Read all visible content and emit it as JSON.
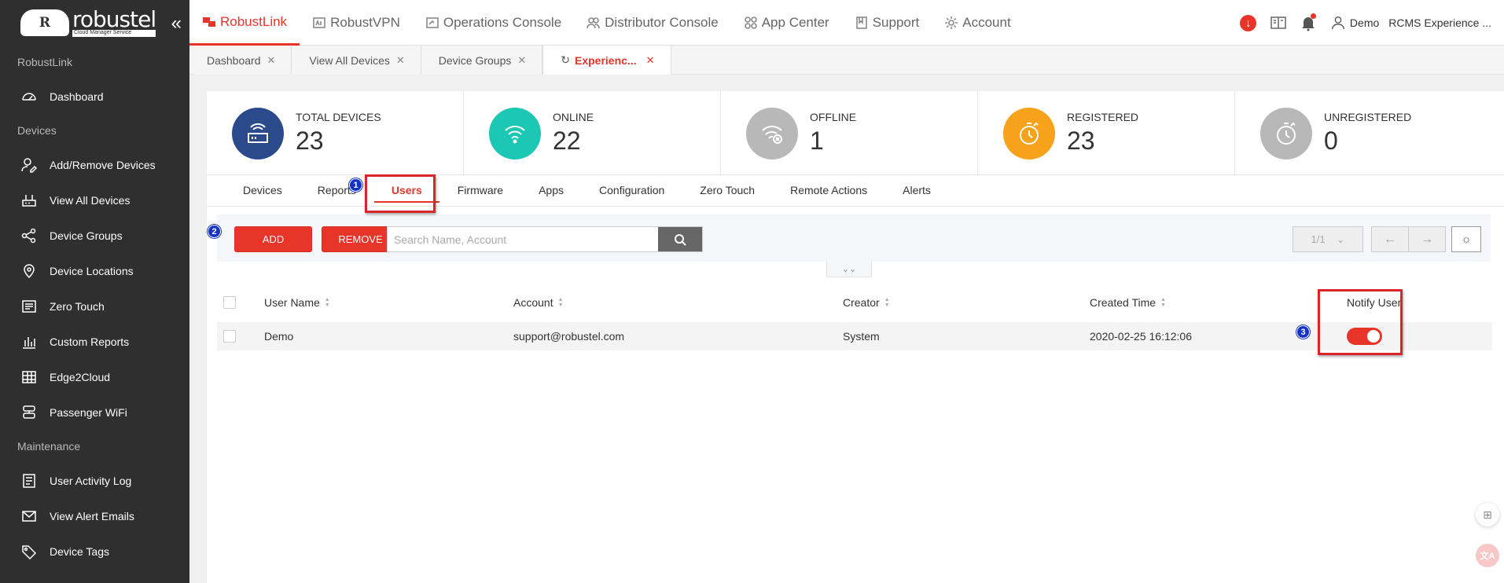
{
  "brand": {
    "name": "robustel",
    "sub": "Cloud Manager Service",
    "badge": "R"
  },
  "sidebar": {
    "sections": [
      {
        "title": "RobustLink",
        "items": [
          {
            "label": "Dashboard",
            "icon": "gauge-icon"
          }
        ]
      },
      {
        "title": "Devices",
        "items": [
          {
            "label": "Add/Remove Devices",
            "icon": "user-edit-icon"
          },
          {
            "label": "View All Devices",
            "icon": "router-icon"
          },
          {
            "label": "Device Groups",
            "icon": "share-icon"
          },
          {
            "label": "Device Locations",
            "icon": "location-pin-icon"
          },
          {
            "label": "Zero Touch",
            "icon": "slides-icon"
          },
          {
            "label": "Custom Reports",
            "icon": "bar-chart-icon"
          },
          {
            "label": "Edge2Cloud",
            "icon": "grid-icon"
          },
          {
            "label": "Passenger WiFi",
            "icon": "server-icon"
          }
        ]
      },
      {
        "title": "Maintenance",
        "items": [
          {
            "label": "User Activity Log",
            "icon": "log-icon"
          },
          {
            "label": "View Alert Emails",
            "icon": "email-icon"
          },
          {
            "label": "Device Tags",
            "icon": "tag-icon"
          }
        ]
      }
    ]
  },
  "topnav": {
    "items": [
      {
        "label": "RobustLink",
        "active": true
      },
      {
        "label": "RobustVPN"
      },
      {
        "label": "Operations Console"
      },
      {
        "label": "Distributor Console"
      },
      {
        "label": "App Center"
      },
      {
        "label": "Support"
      },
      {
        "label": "Account"
      }
    ],
    "user": "Demo",
    "org": "RCMS Experience ..."
  },
  "tabs": [
    {
      "label": "Dashboard"
    },
    {
      "label": "View All Devices"
    },
    {
      "label": "Device Groups"
    },
    {
      "label": "Experienc...",
      "active": true
    }
  ],
  "stats": [
    {
      "label": "TOTAL DEVICES",
      "value": "23",
      "color": "#2b4a8b",
      "icon": "router-icon"
    },
    {
      "label": "ONLINE",
      "value": "22",
      "color": "#1cc7b4",
      "icon": "wifi-icon"
    },
    {
      "label": "OFFLINE",
      "value": "1",
      "color": "#b8b8b8",
      "icon": "wifi-off-icon"
    },
    {
      "label": "REGISTERED",
      "value": "23",
      "color": "#f7a21b",
      "icon": "timer-check-icon"
    },
    {
      "label": "UNREGISTERED",
      "value": "0",
      "color": "#b8b8b8",
      "icon": "timer-check-icon"
    }
  ],
  "subtabs": [
    "Devices",
    "Reports",
    "Users",
    "Firmware",
    "Apps",
    "Configuration",
    "Zero Touch",
    "Remote Actions",
    "Alerts"
  ],
  "toolbar": {
    "add_label": "ADD",
    "remove_label": "REMOVE",
    "search_placeholder": "Search Name, Account",
    "page": "1/1"
  },
  "table": {
    "headers": {
      "user_name": "User Name",
      "account": "Account",
      "creator": "Creator",
      "created_time": "Created Time",
      "notify": "Notify User"
    },
    "rows": [
      {
        "user_name": "Demo",
        "account": "support@robustel.com",
        "creator": "System",
        "created_time": "2020-02-25 16:12:06",
        "notify": true
      }
    ]
  },
  "annotations": [
    "1",
    "2",
    "3"
  ],
  "colors": {
    "accent": "#e8352a",
    "sidebar": "#2f2f2f",
    "badge": "#1432c8"
  }
}
